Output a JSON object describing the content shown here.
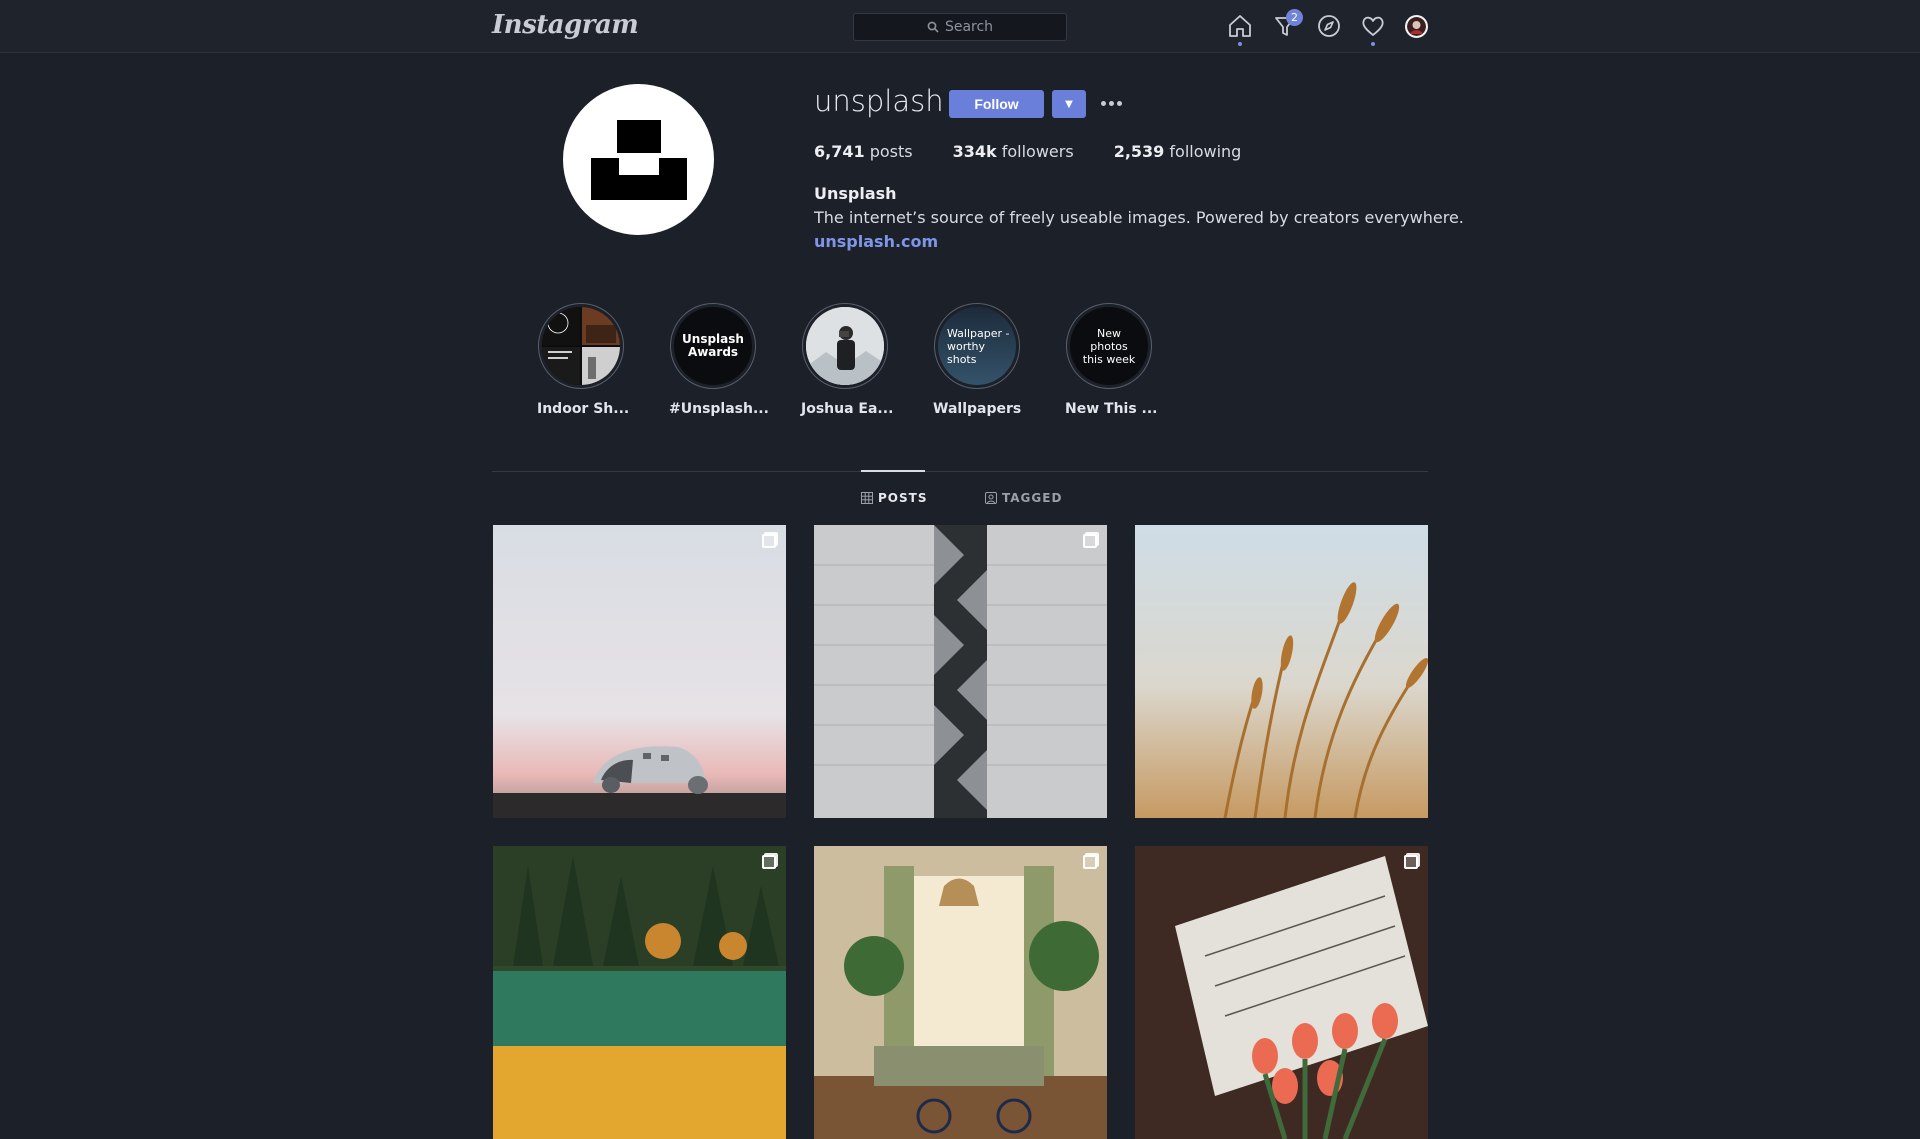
{
  "nav": {
    "logo_text": "Instagram",
    "search_placeholder": "Search",
    "icons": [
      "home-icon",
      "activity-feed-icon",
      "explore-compass-icon",
      "heart-icon",
      "avatar"
    ],
    "notification_count": "2",
    "accent_color": "#6a7fd9"
  },
  "profile": {
    "username": "unsplash",
    "follow_label": "Follow",
    "dropdown_glyph": "▼",
    "stats": {
      "posts_count": "6,741",
      "posts_label": "posts",
      "followers_count": "334k",
      "followers_label": "followers",
      "following_count": "2,539",
      "following_label": "following"
    },
    "full_name": "Unsplash",
    "bio": "The internet’s source of freely useable images. Powered by creators everywhere.",
    "website": "unsplash.com"
  },
  "highlights": [
    {
      "label": "Indoor Sh...",
      "cover_text": ""
    },
    {
      "label": "#Unsplash...",
      "cover_text": "Unsplash Awards"
    },
    {
      "label": "Joshua Ea...",
      "cover_text": ""
    },
    {
      "label": "Wallpapers",
      "cover_text": "Wallpaper -worthy shots"
    },
    {
      "label": "New This ...",
      "cover_text": "New photos this week"
    }
  ],
  "tabs": [
    {
      "label": "POSTS",
      "active": true
    },
    {
      "label": "TAGGED",
      "active": false
    }
  ],
  "posts": [
    {
      "subject": "crashed airplane on black sand beach",
      "multi": true
    },
    {
      "subject": "concrete stairwell architecture",
      "multi": true
    },
    {
      "subject": "golden wheat field",
      "multi": false
    },
    {
      "subject": "autumn forest lake",
      "multi": true
    },
    {
      "subject": "sunlit bedroom with plants and bicycle",
      "multi": true
    },
    {
      "subject": "tulips on New York Times newspaper",
      "multi": true
    }
  ]
}
